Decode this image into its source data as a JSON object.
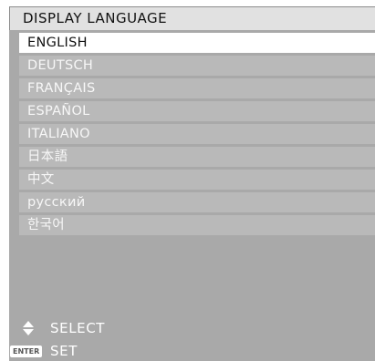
{
  "menu": {
    "title": "DISPLAY LANGUAGE",
    "languages": [
      {
        "label": "ENGLISH",
        "selected": true
      },
      {
        "label": "DEUTSCH",
        "selected": false
      },
      {
        "label": "FRANÇAIS",
        "selected": false
      },
      {
        "label": "ESPAÑOL",
        "selected": false
      },
      {
        "label": "ITALIANO",
        "selected": false
      },
      {
        "label": "日本語",
        "selected": false
      },
      {
        "label": "中文",
        "selected": false
      },
      {
        "label": "русский",
        "selected": false
      },
      {
        "label": "한국어",
        "selected": false
      }
    ]
  },
  "footer": {
    "select_icon": "up-down-arrows-icon",
    "select_label": "SELECT",
    "enter_icon_text": "ENTER",
    "set_label": "SET"
  },
  "colors": {
    "panel_background": "#a9a9a9",
    "item_background": "#b9b9b9",
    "selected_background": "#ffffff",
    "title_background": "#e1e1e1"
  }
}
